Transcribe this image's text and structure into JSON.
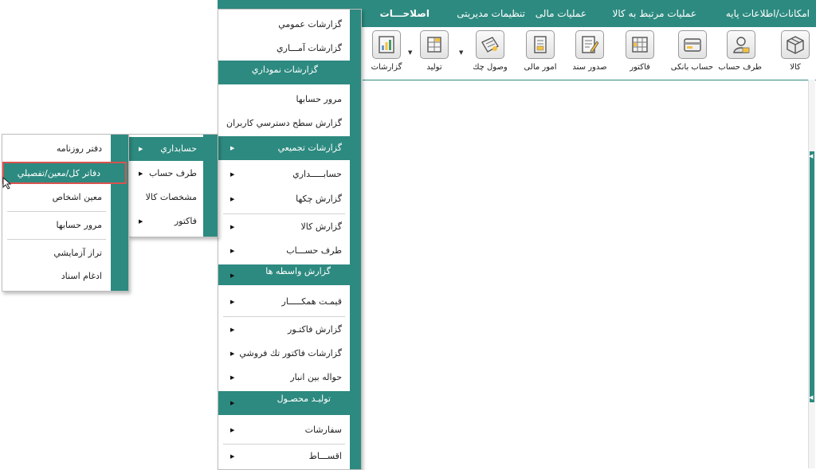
{
  "menubar": {
    "items": [
      {
        "label": "امکانات/اطلاعات پایه"
      },
      {
        "label": "عملیات مرتبط به کالا"
      },
      {
        "label": "عملیات مالی"
      },
      {
        "label": "تنظیمات مدیریتی"
      },
      {
        "label": "اصلاحـــات"
      }
    ]
  },
  "toolbar": {
    "buttons": [
      {
        "label": "کالا",
        "icon": "box-icon"
      },
      {
        "label": "طرف حساب",
        "icon": "person-icon"
      },
      {
        "label": "حساب بانکی",
        "icon": "bank-card-icon"
      },
      {
        "label": "فاکتور",
        "icon": "invoice-icon"
      },
      {
        "label": "صدور سند",
        "icon": "document-pen-icon"
      },
      {
        "label": "امور مالی",
        "icon": "finance-icon"
      },
      {
        "label": "وصول چك",
        "icon": "cheque-icon"
      },
      {
        "label": "تولید",
        "icon": "production-icon"
      },
      {
        "label": "گزارشات",
        "icon": "report-chart-icon"
      }
    ]
  },
  "reports_menu": {
    "items": [
      {
        "label": "گزارشات عمومي"
      },
      {
        "label": "گزارشات آمـــاري"
      },
      {
        "label": "گزارشات نموداري"
      },
      {
        "label": "مرور حسابها"
      },
      {
        "label": "گزارش سطح دسترسي کاربران"
      },
      {
        "label": "گزارشات تجميعي"
      },
      {
        "label": "حسابـــــداري"
      },
      {
        "label": "گزارش چكها"
      },
      {
        "label": "گزارش کالا"
      },
      {
        "label": "طرف حســـاب"
      },
      {
        "label": "گزارش واسطه ها"
      },
      {
        "label": "قيمـت همکـــــار"
      },
      {
        "label": "گزارش فاکتـور"
      },
      {
        "label": "گزارشات فاکتور تك فروشي"
      },
      {
        "label": "حواله بين انبار"
      },
      {
        "label": "توليـد محصـول"
      },
      {
        "label": "سفارشات"
      },
      {
        "label": "اقســـاط"
      }
    ]
  },
  "aggregate_menu": {
    "items": [
      {
        "label": "حسابداري"
      },
      {
        "label": "طرف حساب"
      },
      {
        "label": "مشخصات کالا"
      },
      {
        "label": "فاکتور"
      }
    ]
  },
  "accounting_menu": {
    "items": [
      {
        "label": "دفتر روزنامه"
      },
      {
        "label": "دفاتر کل/معين/تفصيلي"
      },
      {
        "label": "معين اشخاص"
      },
      {
        "label": "مرور حسابها"
      },
      {
        "label": "تراز آزمايشي"
      },
      {
        "label": "ادغام اسناد"
      }
    ]
  },
  "colors": {
    "accent": "#2d8a80",
    "highlight": "#2d8a80",
    "selection_border": "#d9534f"
  }
}
